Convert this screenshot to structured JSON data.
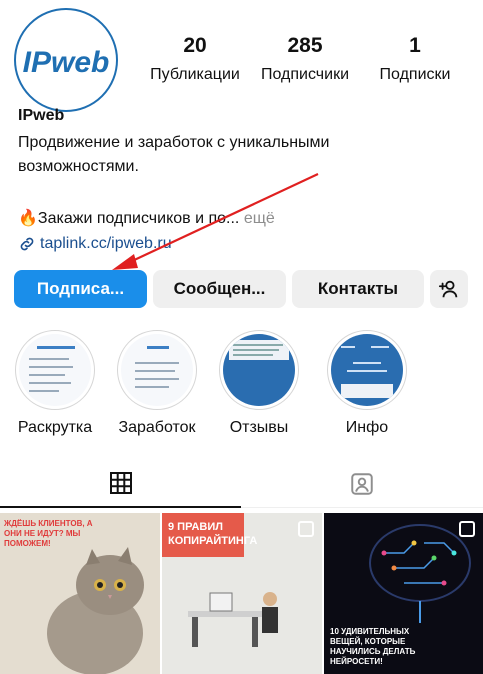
{
  "profile": {
    "logo_text": "IPweb",
    "username": "IPweb",
    "bio": "Продвижение и заработок с уникальными возможностями.",
    "promo": "🔥Закажи подписчиков и по...",
    "promo_more": "ещё",
    "link": "taplink.cc/ipweb.ru"
  },
  "stats": [
    {
      "value": "20",
      "label": "Публикации"
    },
    {
      "value": "285",
      "label": "Подписчики"
    },
    {
      "value": "1",
      "label": "Подписки"
    }
  ],
  "buttons": {
    "subscribe": "Подписа...",
    "message": "Сообщен...",
    "contacts": "Контакты"
  },
  "highlights": [
    {
      "label": "Раскрутка",
      "icon": "price-list-thumbnail"
    },
    {
      "label": "Заработок",
      "icon": "earnings-thumbnail"
    },
    {
      "label": "Отзывы",
      "icon": "reviews-thumbnail"
    },
    {
      "label": "Инфо",
      "icon": "info-thumbnail"
    }
  ],
  "posts": [
    {
      "caption": "ЖДЁШЬ КЛИЕНТОВ, А ОНИ НЕ ИДУТ? МЫ ПОМОЖЕМ!",
      "image": "cat-photo"
    },
    {
      "caption": "9 ПРАВИЛ КОПИРАЙТИНГА",
      "image": "desk-figure-photo"
    },
    {
      "caption": "10 УДИВИТЕЛЬНЫХ ВЕЩЕЙ, КОТОРЫЕ НАУЧИЛИСЬ ДЕЛАТЬ НЕЙРОСЕТИ!",
      "image": "neural-brain-graphic"
    }
  ],
  "colors": {
    "accent": "#1a8eea",
    "annotation_arrow": "#e02020",
    "link": "#1b4f8f"
  }
}
